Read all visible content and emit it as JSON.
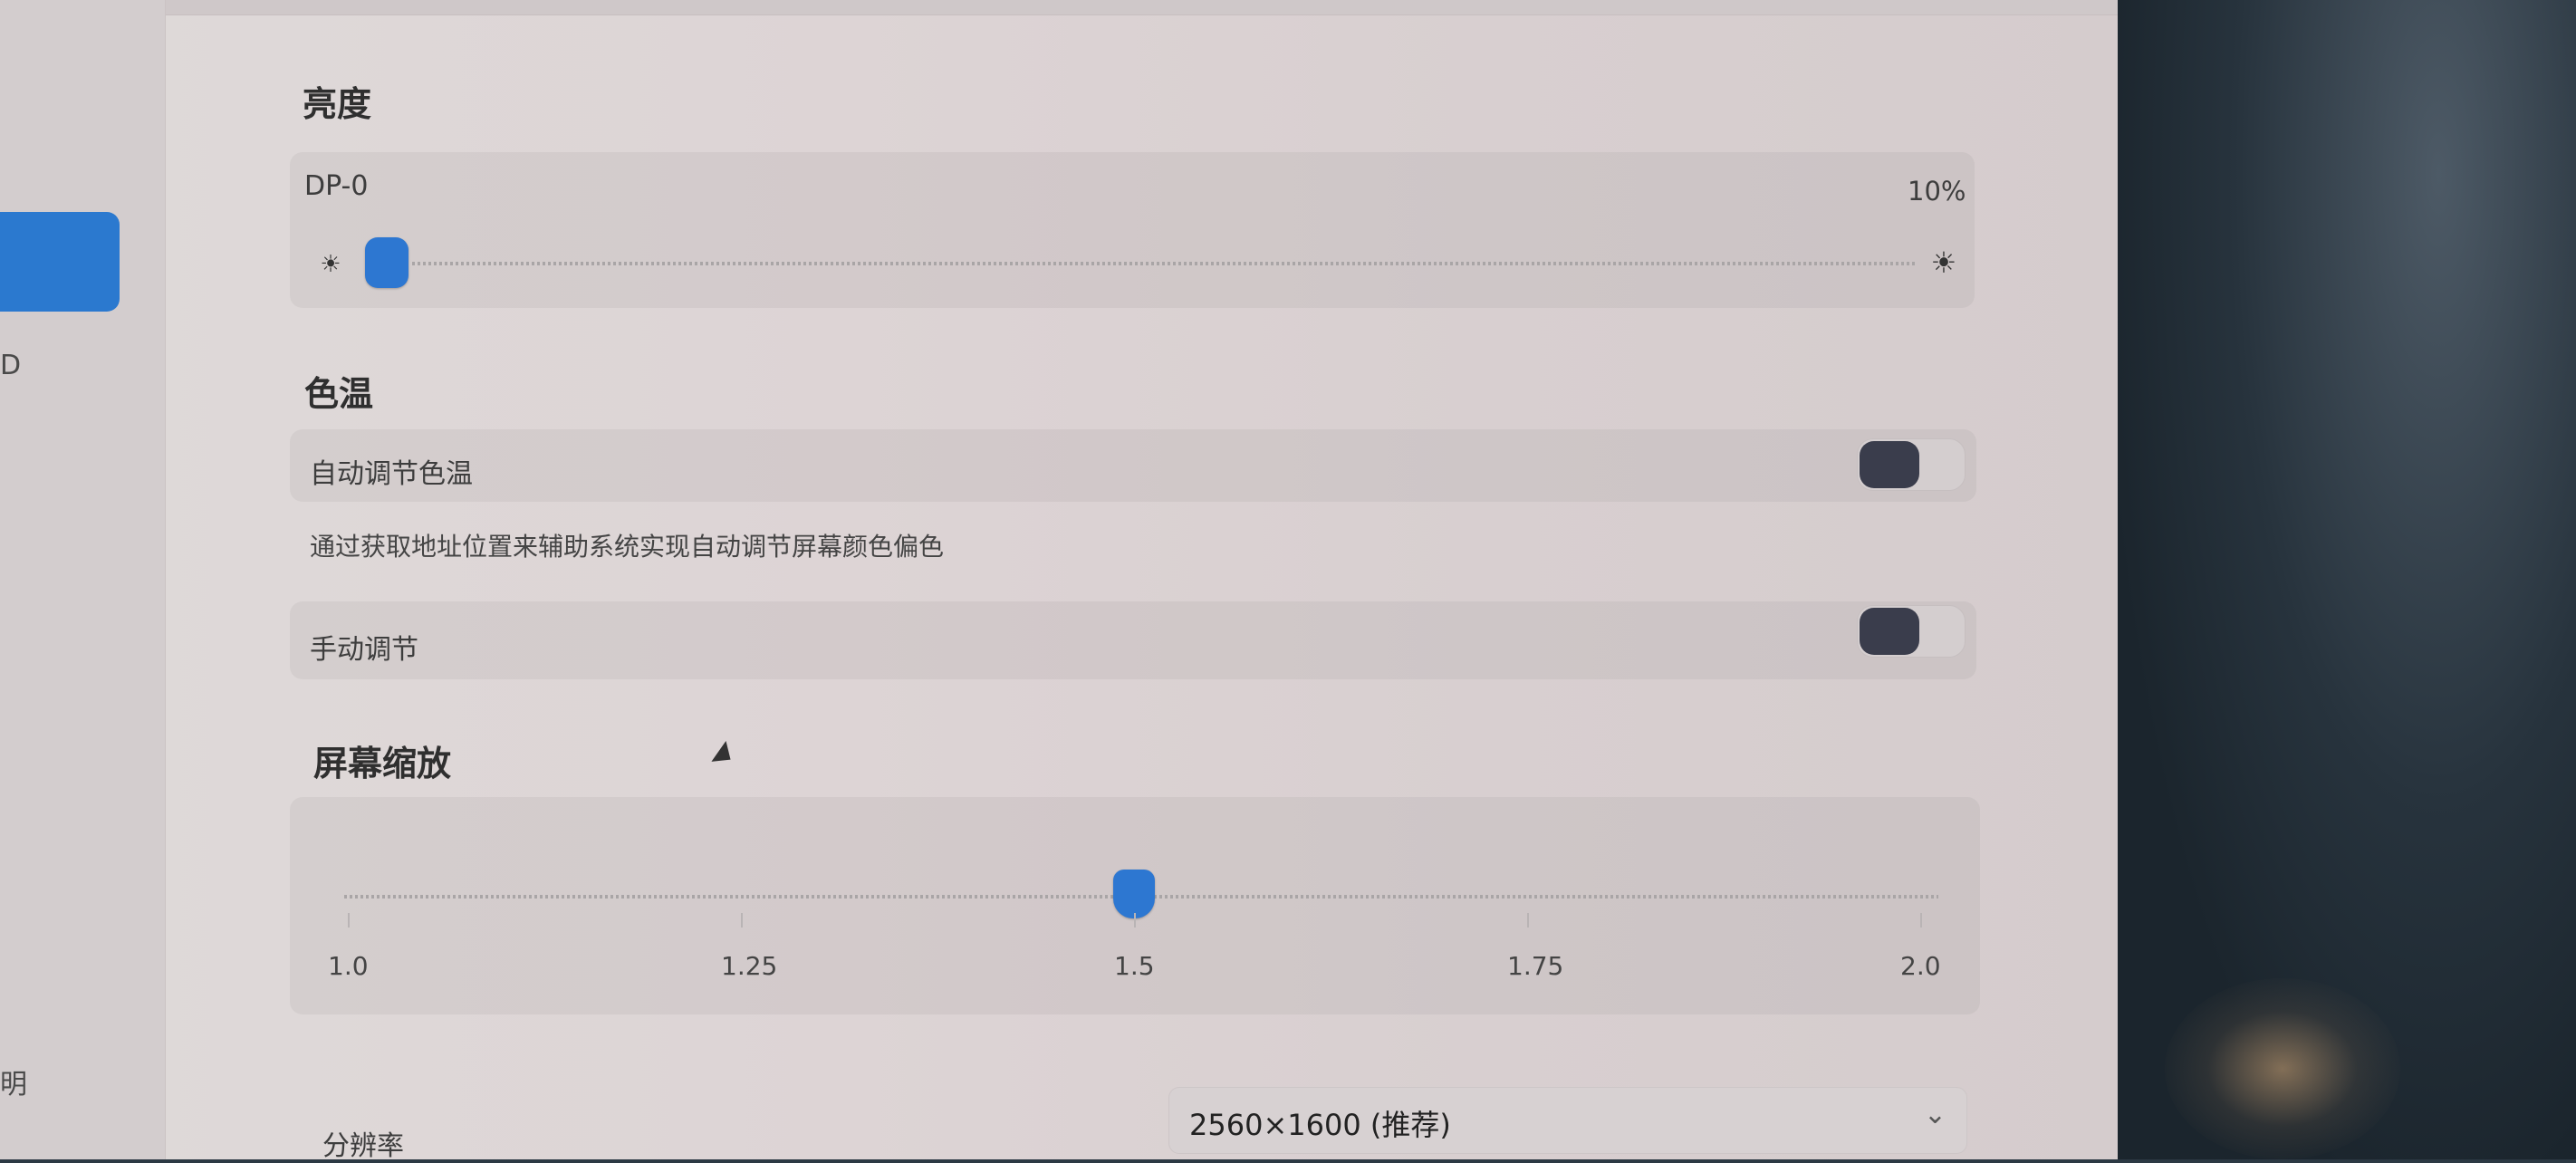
{
  "sidebar": {
    "fragment_top": "D",
    "fragment_bottom": "明"
  },
  "brightness": {
    "title": "亮度",
    "display": "DP-0",
    "value_text": "10%",
    "value": 0.1
  },
  "color_temp": {
    "title": "色温",
    "auto_label": "自动调节色温",
    "auto_desc": "通过获取地址位置来辅助系统实现自动调节屏幕颜色偏色",
    "manual_label": "手动调节",
    "auto_enabled": false,
    "manual_enabled": false
  },
  "scaling": {
    "title": "屏幕缩放",
    "ticks": [
      "1.0",
      "1.25",
      "1.5",
      "1.75",
      "2.0"
    ],
    "value": 1.5
  },
  "resolution": {
    "label": "分辨率",
    "value": "2560×1600 (推荐)"
  },
  "colors": {
    "accent": "#2d77d1",
    "toggle_knob": "#3a3d4c"
  }
}
